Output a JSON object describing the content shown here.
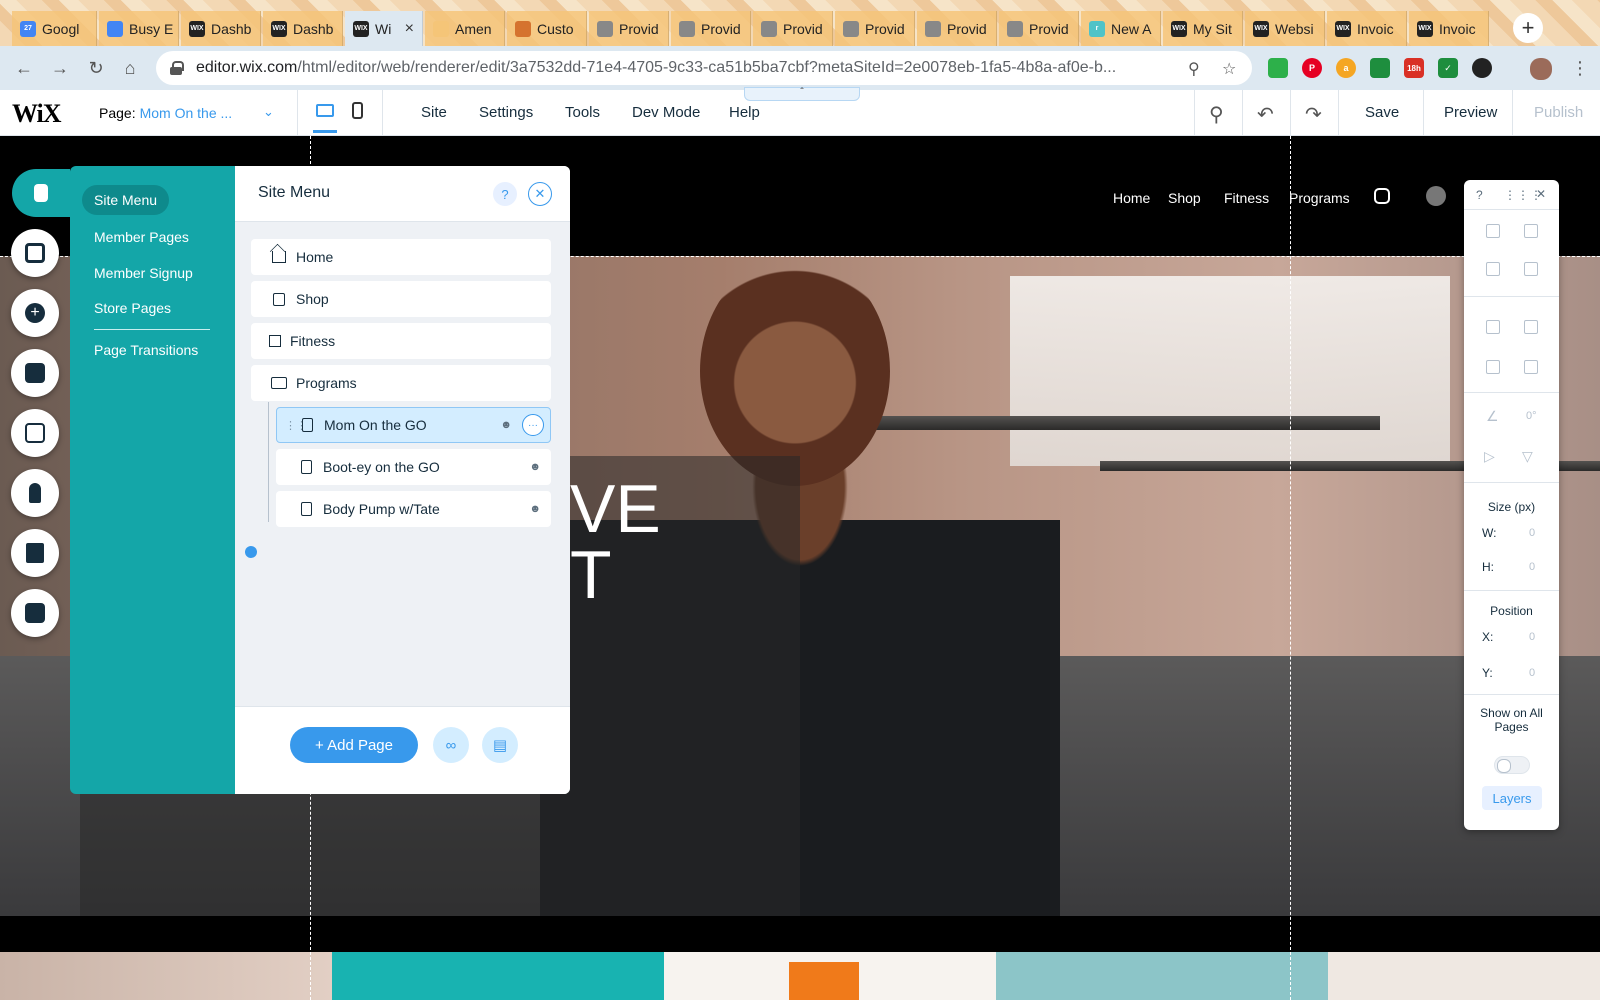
{
  "browser": {
    "tabs": [
      {
        "label": "Googl",
        "fav": "calendar-favicon",
        "color": "#4285f4"
      },
      {
        "label": "Busy E",
        "fav": "doc-favicon",
        "color": "#4285f4"
      },
      {
        "label": "Dashb",
        "fav": "wix-favicon",
        "color": "#222222"
      },
      {
        "label": "Dashb",
        "fav": "wix-favicon",
        "color": "#222222"
      },
      {
        "label": "Wi",
        "fav": "wix-favicon",
        "color": "#222222",
        "active": true
      },
      {
        "label": "Amen",
        "fav": "blank-favicon",
        "color": "#f5c578"
      },
      {
        "label": "Custo",
        "fav": "chart-favicon",
        "color": "#d5732f"
      },
      {
        "label": "Provid",
        "fav": "c-favicon",
        "color": "#888888"
      },
      {
        "label": "Provid",
        "fav": "c-favicon",
        "color": "#888888"
      },
      {
        "label": "Provid",
        "fav": "c-favicon",
        "color": "#888888"
      },
      {
        "label": "Provid",
        "fav": "c-favicon",
        "color": "#888888"
      },
      {
        "label": "Provid",
        "fav": "c-favicon",
        "color": "#888888"
      },
      {
        "label": "Provid",
        "fav": "c-favicon",
        "color": "#888888"
      },
      {
        "label": "New A",
        "fav": "r-favicon",
        "color": "#4fc3c8"
      },
      {
        "label": "My Sit",
        "fav": "wix-favicon",
        "color": "#222222"
      },
      {
        "label": "Websi",
        "fav": "wix-favicon",
        "color": "#222222"
      },
      {
        "label": "Invoic",
        "fav": "wix-favicon",
        "color": "#222222"
      },
      {
        "label": "Invoic",
        "fav": "wix-favicon",
        "color": "#222222"
      }
    ],
    "fav_text": {
      "wix": "WIX",
      "calendar": "27",
      "r": "r"
    },
    "url_main": "editor.wix.com",
    "url_rest": "/html/editor/web/renderer/edit/3a7532dd-71e4-4705-9c33-ca51b5ba7cbf?metaSiteId=2e0078eb-1fa5-4b8a-af0e-b...",
    "ext_badge": "18h"
  },
  "editor": {
    "logo": "WiX",
    "page_label": "Page:",
    "page_value": "Mom On the ...",
    "menu": [
      "Site",
      "Settings",
      "Tools",
      "Dev Mode",
      "Help"
    ],
    "save": "Save",
    "preview": "Preview",
    "publish": "Publish"
  },
  "site": {
    "nav": [
      "Home",
      "Shop",
      "Fitness",
      "Programs"
    ],
    "hero_text_line1": "VE",
    "hero_text_line2": "T"
  },
  "left_toolbar": [
    "pages-icon",
    "background-icon",
    "add-icon",
    "add-apps-icon",
    "media-icon",
    "blog-icon",
    "store-icon",
    "bookings-icon"
  ],
  "pages_panel": {
    "categories": [
      "Site Menu",
      "Member Pages",
      "Member Signup",
      "Store Pages",
      "Page Transitions"
    ],
    "title": "Site Menu",
    "help": "?",
    "pages": [
      {
        "label": "Home",
        "icon": "home-icon"
      },
      {
        "label": "Shop",
        "icon": "shop-bag-icon"
      },
      {
        "label": "Fitness",
        "icon": "dynamic-page-icon"
      },
      {
        "label": "Programs",
        "icon": "folder-icon"
      }
    ],
    "subpages": [
      {
        "label": "Mom On the GO",
        "selected": true
      },
      {
        "label": "Boot-ey on the GO",
        "selected": false
      },
      {
        "label": "Body Pump w/Tate",
        "selected": false
      }
    ],
    "add_page": "+ Add Page"
  },
  "inspector": {
    "help": "?",
    "rotation": "0°",
    "size_title": "Size (px)",
    "w_label": "W:",
    "w_value": "0",
    "h_label": "H:",
    "h_value": "0",
    "position_title": "Position",
    "x_label": "X:",
    "x_value": "0",
    "y_label": "Y:",
    "y_value": "0",
    "show_all": "Show on All Pages",
    "layers": "Layers"
  },
  "colors": {
    "teal": "#14a6a8",
    "accent_blue": "#3899ec",
    "panel_bg": "#eef1f5"
  }
}
